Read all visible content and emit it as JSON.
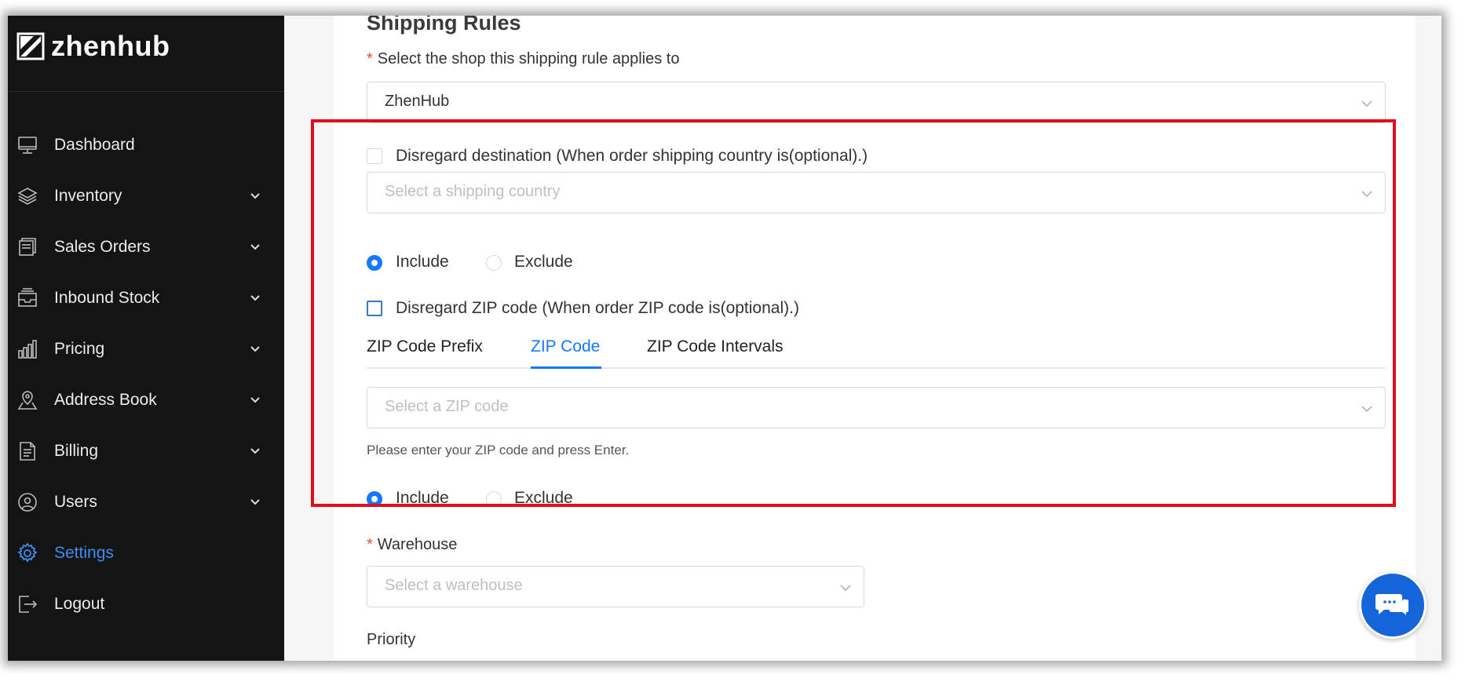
{
  "app": {
    "name": "zhenhub"
  },
  "sidebar": {
    "items": [
      {
        "label": "Dashboard",
        "icon": "monitor-icon",
        "has_chevron": false,
        "active": false
      },
      {
        "label": "Inventory",
        "icon": "layers-icon",
        "has_chevron": true,
        "active": false
      },
      {
        "label": "Sales Orders",
        "icon": "folder-icon",
        "has_chevron": true,
        "active": false
      },
      {
        "label": "Inbound Stock",
        "icon": "inbox-icon",
        "has_chevron": true,
        "active": false
      },
      {
        "label": "Pricing",
        "icon": "bar-chart-icon",
        "has_chevron": true,
        "active": false
      },
      {
        "label": "Address Book",
        "icon": "map-pin-icon",
        "has_chevron": true,
        "active": false
      },
      {
        "label": "Billing",
        "icon": "document-icon",
        "has_chevron": true,
        "active": false
      },
      {
        "label": "Users",
        "icon": "globe-user-icon",
        "has_chevron": true,
        "active": false
      },
      {
        "label": "Settings",
        "icon": "gear-icon",
        "has_chevron": false,
        "active": true
      },
      {
        "label": "Logout",
        "icon": "logout-icon",
        "has_chevron": false,
        "active": false
      }
    ]
  },
  "form": {
    "title": "Shipping Rules",
    "shop": {
      "label": "Select the shop this shipping rule applies to",
      "value": "ZhenHub"
    },
    "destination": {
      "checkbox_label": "Disregard destination (When order shipping country is(optional).)",
      "placeholder": "Select a shipping country",
      "include_label": "Include",
      "exclude_label": "Exclude",
      "selected": "Include"
    },
    "zip": {
      "checkbox_label": "Disregard ZIP code (When order ZIP code is(optional).)",
      "tabs": [
        "ZIP Code Prefix",
        "ZIP Code",
        "ZIP Code Intervals"
      ],
      "active_tab": "ZIP Code",
      "placeholder": "Select a ZIP code",
      "help": "Please enter your ZIP code and press Enter.",
      "include_label": "Include",
      "exclude_label": "Exclude",
      "selected": "Include"
    },
    "warehouse": {
      "label": "Warehouse",
      "placeholder": "Select a warehouse"
    },
    "priority": {
      "label": "Priority"
    }
  },
  "colors": {
    "accent": "#1677ff",
    "sidebar_bg": "#141414",
    "highlight": "#e10e1c",
    "chat": "#1565d8"
  }
}
